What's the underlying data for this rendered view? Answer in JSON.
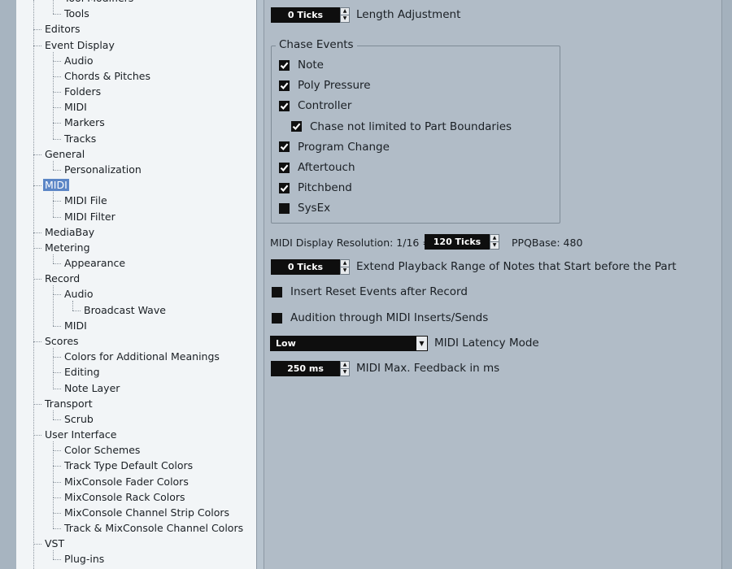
{
  "tree": {
    "items": [
      {
        "label": "Tool Modifiers",
        "depth": 1
      },
      {
        "label": "Tools",
        "depth": 1
      },
      {
        "label": "Editors",
        "depth": 0
      },
      {
        "label": "Event Display",
        "depth": 0
      },
      {
        "label": "Audio",
        "depth": 1
      },
      {
        "label": "Chords & Pitches",
        "depth": 1
      },
      {
        "label": "Folders",
        "depth": 1
      },
      {
        "label": "MIDI",
        "depth": 1
      },
      {
        "label": "Markers",
        "depth": 1
      },
      {
        "label": "Tracks",
        "depth": 1
      },
      {
        "label": "General",
        "depth": 0
      },
      {
        "label": "Personalization",
        "depth": 1
      },
      {
        "label": "MIDI",
        "depth": 0,
        "selected": true
      },
      {
        "label": "MIDI File",
        "depth": 1
      },
      {
        "label": "MIDI Filter",
        "depth": 1
      },
      {
        "label": "MediaBay",
        "depth": 0
      },
      {
        "label": "Metering",
        "depth": 0
      },
      {
        "label": "Appearance",
        "depth": 1
      },
      {
        "label": "Record",
        "depth": 0
      },
      {
        "label": "Audio",
        "depth": 1
      },
      {
        "label": "Broadcast Wave",
        "depth": 2
      },
      {
        "label": "MIDI",
        "depth": 1
      },
      {
        "label": "Scores",
        "depth": 0
      },
      {
        "label": "Colors for Additional Meanings",
        "depth": 1
      },
      {
        "label": "Editing",
        "depth": 1
      },
      {
        "label": "Note Layer",
        "depth": 1
      },
      {
        "label": "Transport",
        "depth": 0
      },
      {
        "label": "Scrub",
        "depth": 1
      },
      {
        "label": "User Interface",
        "depth": 0
      },
      {
        "label": "Color Schemes",
        "depth": 1
      },
      {
        "label": "Track Type Default Colors",
        "depth": 1
      },
      {
        "label": "MixConsole Fader Colors",
        "depth": 1
      },
      {
        "label": "MixConsole Rack Colors",
        "depth": 1
      },
      {
        "label": "MixConsole Channel Strip Colors",
        "depth": 1
      },
      {
        "label": "Track & MixConsole Channel Colors",
        "depth": 1
      },
      {
        "label": "VST",
        "depth": 0
      },
      {
        "label": "Plug-ins",
        "depth": 1
      }
    ]
  },
  "length_adjustment": {
    "value": "0 Ticks",
    "label": "Length Adjustment"
  },
  "chase_events": {
    "title": "Chase Events",
    "items": [
      {
        "label": "Note",
        "checked": true
      },
      {
        "label": "Poly Pressure",
        "checked": true
      },
      {
        "label": "Controller",
        "checked": true
      },
      {
        "label": "Chase not limited to Part Boundaries",
        "checked": true
      },
      {
        "label": "Program Change",
        "checked": true
      },
      {
        "label": "Aftertouch",
        "checked": true
      },
      {
        "label": "Pitchbend",
        "checked": true
      },
      {
        "label": "SysEx",
        "checked": false
      }
    ]
  },
  "display_resolution": {
    "label": "MIDI Display Resolution: 1/16 =",
    "value": "120 Ticks",
    "ppq": "PPQBase: 480"
  },
  "extend_playback": {
    "value": "0 Ticks",
    "label": "Extend Playback Range of Notes that Start before the Part"
  },
  "insert_reset": {
    "label": "Insert Reset Events after Record",
    "checked": false
  },
  "audition": {
    "label": "Audition through MIDI Inserts/Sends",
    "checked": false
  },
  "latency_mode": {
    "value": "Low",
    "label": "MIDI Latency Mode"
  },
  "max_feedback": {
    "value": "250 ms",
    "label": "MIDI Max. Feedback in ms"
  },
  "colors": {
    "selection": "#5c86c6",
    "field": "#0e0e0e",
    "panel": "#b1bcc7",
    "tree_bg": "#f2f5f7"
  }
}
